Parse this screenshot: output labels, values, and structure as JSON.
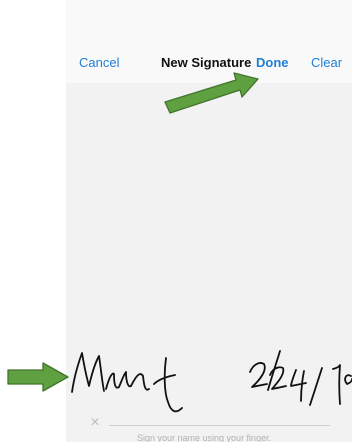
{
  "nav": {
    "cancel_label": "Cancel",
    "title": "New Signature",
    "done_label": "Done",
    "clear_label": "Clear"
  },
  "signature_pad": {
    "hint": "Sign your name using your finger.",
    "clear_icon": "x-icon"
  },
  "annotations": {
    "arrow_color": "#5fa040",
    "arrow_border": "#41742c",
    "ink_color": "#111111"
  }
}
